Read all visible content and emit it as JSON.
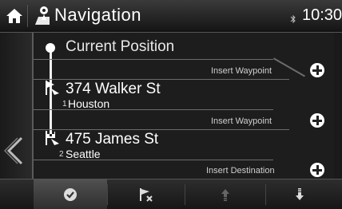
{
  "header": {
    "title": "Navigation",
    "time": "10:30"
  },
  "route": {
    "current_position_label": "Current Position",
    "stops": [
      {
        "index": "1",
        "street": "374 Walker St",
        "city": "Houston"
      },
      {
        "index": "2",
        "street": "475 James St",
        "city": "Seattle"
      }
    ],
    "insert_labels": [
      "Insert Waypoint",
      "Insert Waypoint",
      "Insert Destination"
    ]
  },
  "toolbar": {
    "buttons": [
      "confirm-route",
      "remove-destination",
      "move-up",
      "move-down"
    ]
  },
  "icons": {
    "home": "home-icon",
    "navigation": "navigation-icon",
    "bluetooth": "bluetooth-icon",
    "back": "chevron-left-icon",
    "plus": "plus-circle-icon",
    "waypoint_flag": "waypoint-flag-icon",
    "destination_flag": "destination-flag-icon",
    "check": "check-circle-icon",
    "flag_remove": "flag-remove-icon",
    "arrow_up": "arrow-up-icon",
    "arrow_down": "arrow-down-icon"
  },
  "colors": {
    "background": "#1d1d1d",
    "text": "#ffffff",
    "line": "#6b6b6b"
  }
}
